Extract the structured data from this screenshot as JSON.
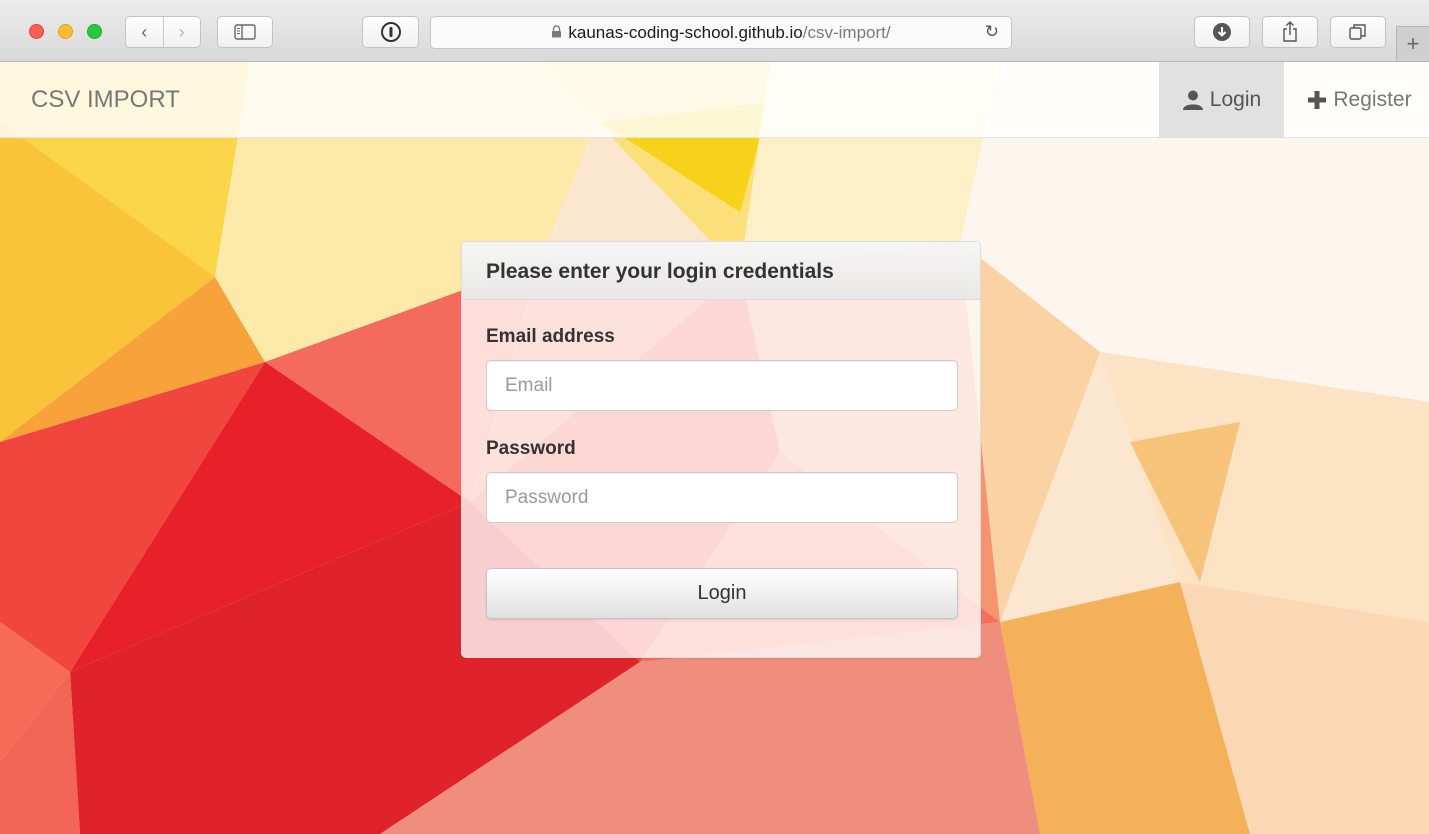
{
  "browser": {
    "url_host": "kaunas-coding-school.github.io",
    "url_path": "/csv-import/",
    "back_icon": "chevron-left-icon",
    "forward_icon": "chevron-right-icon",
    "sidebar_icon": "sidebar-icon",
    "extension_icon": "password-manager-icon",
    "reload_icon": "reload-icon",
    "download_icon": "download-icon",
    "share_icon": "share-icon",
    "tabs_icon": "tabs-icon",
    "new_tab_icon": "plus-icon",
    "glyphs": {
      "back": "‹",
      "forward": "›",
      "reload": "↻",
      "new_tab": "+"
    }
  },
  "navbar": {
    "brand": "CSV IMPORT",
    "login_label": "Login",
    "register_label": "Register",
    "login_icon": "user-icon",
    "register_icon": "plus-icon"
  },
  "login_panel": {
    "heading": "Please enter your login credentials",
    "email_label": "Email address",
    "email_placeholder": "Email",
    "email_value": "",
    "password_label": "Password",
    "password_placeholder": "Password",
    "password_value": "",
    "submit_label": "Login"
  },
  "colors": {
    "background_red": "#e8202a",
    "background_yellow": "#fbd54a",
    "background_orange": "#f7a23a"
  }
}
